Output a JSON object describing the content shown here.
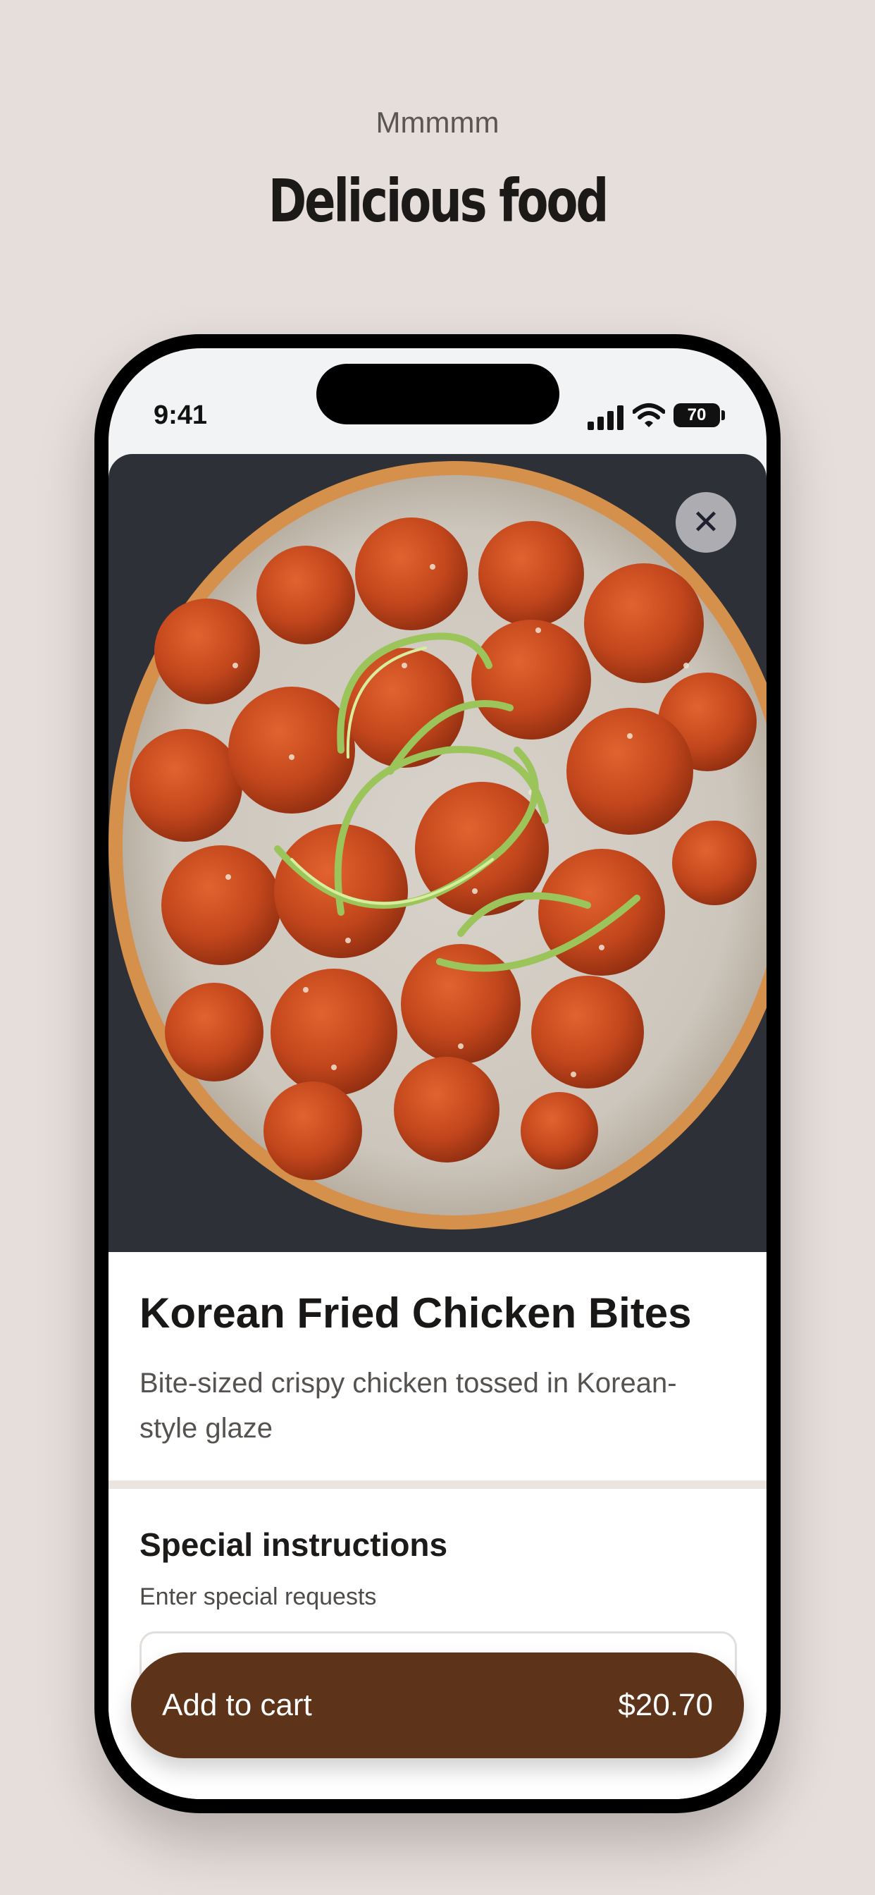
{
  "promo": {
    "eyebrow": "Mmmmm",
    "headline": "Delicious food"
  },
  "status_bar": {
    "time": "9:41",
    "battery": "70"
  },
  "item": {
    "image": "korean-fried-chicken-plate",
    "title": "Korean Fried Chicken Bites",
    "description": "Bite-sized crispy chicken tossed in Korean-style glaze"
  },
  "special_instructions": {
    "title": "Special instructions",
    "subtitle": "Enter special requests",
    "value": ""
  },
  "cart": {
    "label": "Add to cart",
    "price": "$20.70"
  },
  "icons": {
    "close": "close-icon",
    "signal": "signal-icon",
    "wifi": "wifi-icon",
    "battery": "battery-icon"
  },
  "colors": {
    "background": "#e6dedb",
    "cart_button": "#5d3419",
    "title_text": "#191817"
  }
}
